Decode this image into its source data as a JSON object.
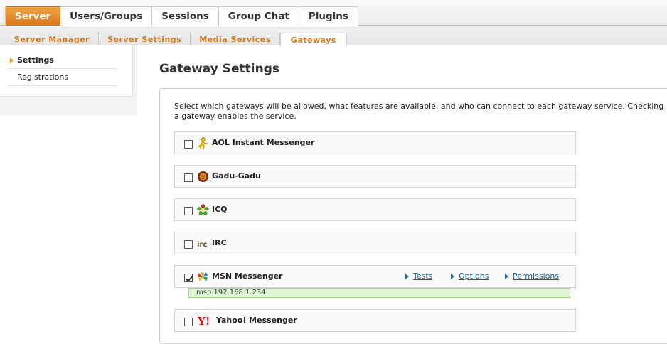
{
  "top_tabs": [
    {
      "label": "Server",
      "active": true
    },
    {
      "label": "Users/Groups",
      "active": false
    },
    {
      "label": "Sessions",
      "active": false
    },
    {
      "label": "Group Chat",
      "active": false
    },
    {
      "label": "Plugins",
      "active": false
    }
  ],
  "sub_tabs": [
    {
      "label": "Server Manager",
      "active": false
    },
    {
      "label": "Server Settings",
      "active": false
    },
    {
      "label": "Media Services",
      "active": false
    },
    {
      "label": "Gateways",
      "active": true
    }
  ],
  "sidebar": {
    "items": [
      {
        "label": "Settings",
        "active": true
      },
      {
        "label": "Registrations",
        "active": false
      }
    ]
  },
  "main": {
    "title": "Gateway Settings",
    "intro": "Select which gateways will be allowed, what features are available, and who can connect to each gateway service. Checking a gateway enables the service.",
    "gateways": [
      {
        "name": "AOL Instant Messenger",
        "icon": "aim-running-man-icon",
        "checked": false
      },
      {
        "name": "Gadu-Gadu",
        "icon": "gadu-gadu-flower-icon",
        "checked": false
      },
      {
        "name": "ICQ",
        "icon": "icq-flower-icon",
        "checked": false
      },
      {
        "name": "IRC",
        "icon": "irc-icon",
        "checked": false
      },
      {
        "name": "MSN Messenger",
        "icon": "msn-butterfly-icon",
        "checked": true,
        "links": {
          "tests": "Tests",
          "options": "Options",
          "permissions": "Permissions"
        },
        "domain": "msn.192.168.1.234"
      },
      {
        "name": "Yahoo! Messenger",
        "icon": "yahoo-icon",
        "checked": false
      }
    ]
  },
  "colors": {
    "accent_orange": "#d8791a",
    "link_blue": "#1a5a8a",
    "domain_green": "#dff5d6"
  }
}
